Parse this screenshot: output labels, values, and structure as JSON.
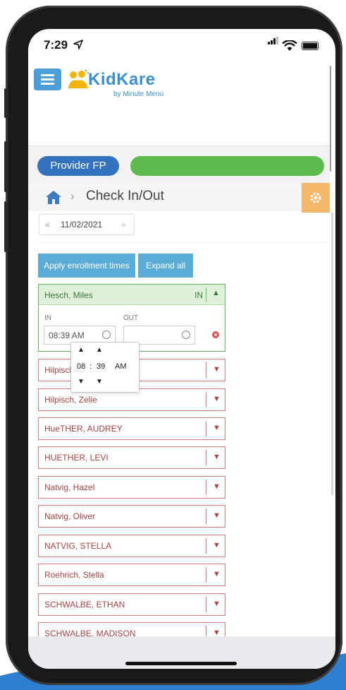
{
  "status_bar": {
    "time": "7:29",
    "location_arrow": "location-arrow-icon"
  },
  "header": {
    "logo_text": "KidKare",
    "logo_sub": "by Minute Menu"
  },
  "provider_button": "Provider FP",
  "breadcrumb": {
    "separator": "›",
    "title": "Check In/Out"
  },
  "date_nav": {
    "prev": "«",
    "date": "11/02/2021",
    "next": "»"
  },
  "actions": {
    "apply": "Apply enrollment times",
    "expand": "Expand all"
  },
  "open_child": {
    "name": "Hesch, Miles",
    "status": "IN",
    "in_label": "IN",
    "out_label": "OUT",
    "in_value": "08:39 AM",
    "out_value": ""
  },
  "time_picker": {
    "hour": "08",
    "sep": ":",
    "minute": "39",
    "ampm": "AM"
  },
  "children": [
    "Hilpisch, Carter",
    "Hilpisch, Zelie",
    "HueTHER, AUDREY",
    "HUETHER, LEVI",
    "Natvig, Hazel",
    "Natvig, Oliver",
    "NATVIG, STELLA",
    "Roehrich, Stella",
    "SCHWALBE, ETHAN",
    "SCHWALBE, MADISON"
  ],
  "colors": {
    "accent_blue": "#3372be",
    "green": "#5dbb4e",
    "orange_tab": "#f4b86a",
    "checked_in_border": "#5cb85c",
    "checked_out_border": "#d27b7b"
  }
}
